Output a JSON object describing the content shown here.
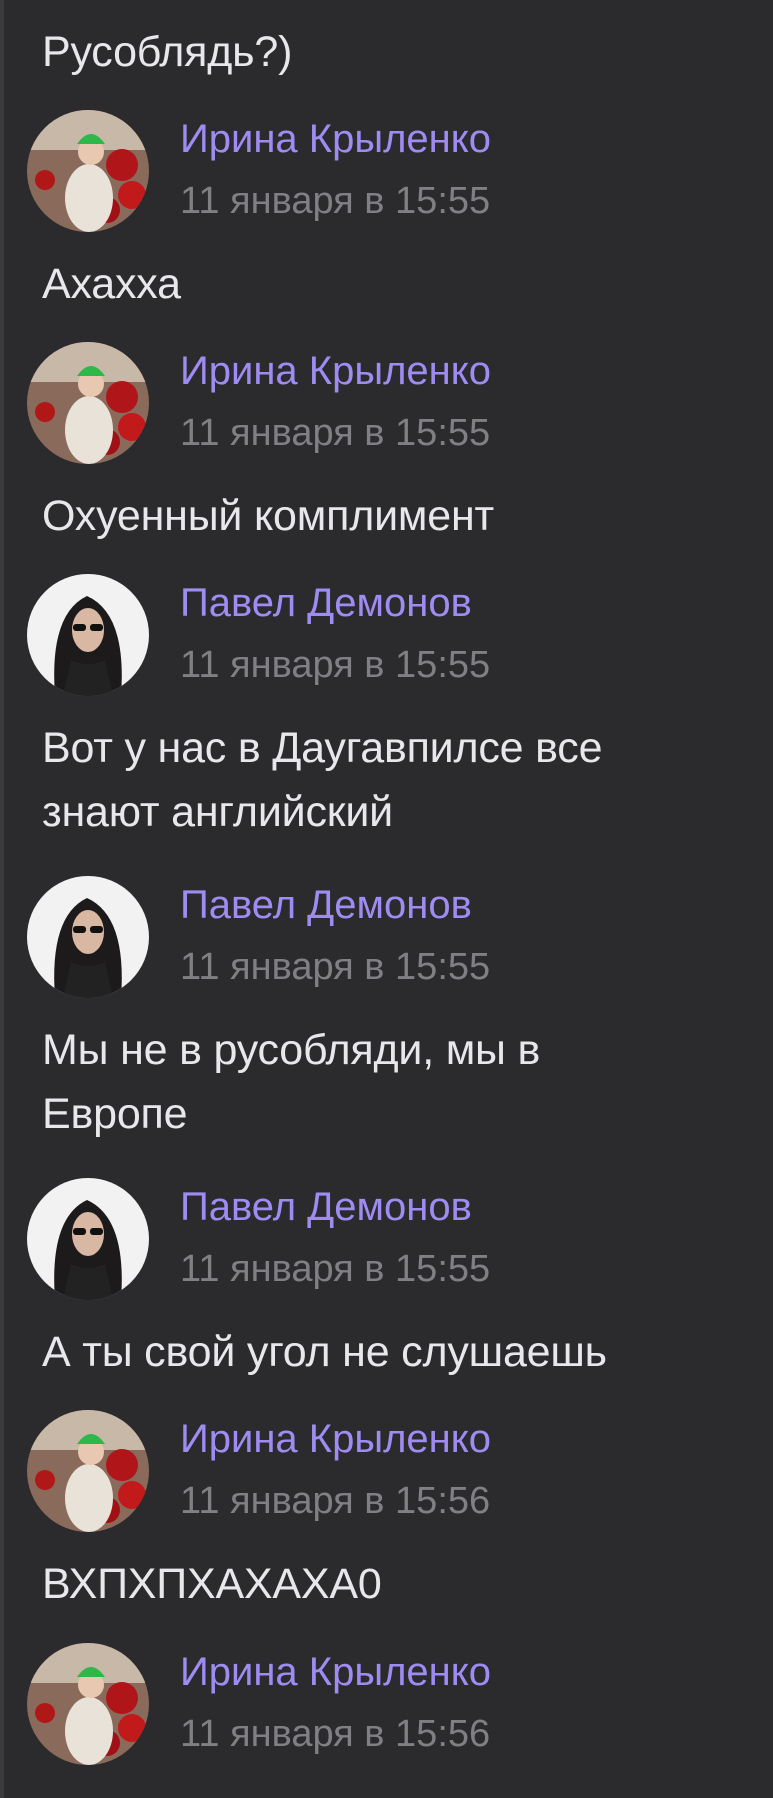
{
  "colors": {
    "background": "#2b2b2e",
    "author_name": "#9f8cf2",
    "timestamp": "#7f7f84",
    "message_text": "#e8e8ec"
  },
  "messages": [
    {
      "text": "Русоблядь?)"
    },
    {
      "author": "Ирина Крыленко",
      "time": "11 января в 15:55",
      "text": "Ахахха",
      "avatar": "avatar-irina"
    },
    {
      "author": "Ирина Крыленко",
      "time": "11 января в 15:55",
      "text": "Охуенный комплимент",
      "avatar": "avatar-irina"
    },
    {
      "author": "Павел Демонов",
      "time": "11 января в 15:55",
      "text_lines": [
        "Вот у нас в Даугавпилсе все",
        "знают английский"
      ],
      "avatar": "avatar-pavel"
    },
    {
      "author": "Павел Демонов",
      "time": "11 января в 15:55",
      "text_lines": [
        "Мы не в русобляди, мы в",
        "Европе"
      ],
      "avatar": "avatar-pavel"
    },
    {
      "author": "Павел Демонов",
      "time": "11 января в 15:55",
      "text": "А ты свой угол не слушаешь",
      "avatar": "avatar-pavel"
    },
    {
      "author": "Ирина Крыленко",
      "time": "11 января в 15:56",
      "text": "ВХПХПХАХАХА0",
      "avatar": "avatar-irina"
    },
    {
      "author": "Ирина Крыленко",
      "time": "11 января в 15:56",
      "avatar": "avatar-irina"
    }
  ]
}
